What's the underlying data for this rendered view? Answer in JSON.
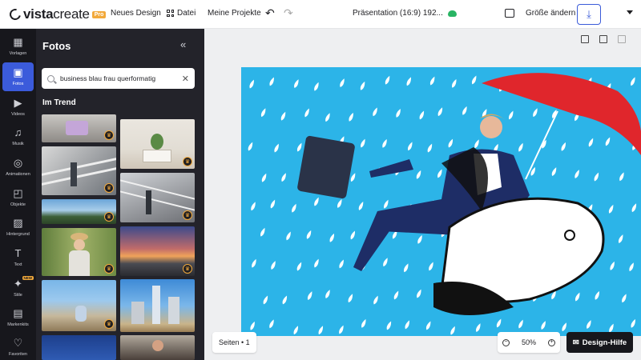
{
  "app": {
    "brand_bold": "vista",
    "brand_light": "create",
    "pro_badge": "Pro"
  },
  "topbar": {
    "new_design": "Neues Design",
    "file": "Datei",
    "my_projects": "Meine Projekte",
    "presentation_title": "Präsentation (16:9) 192...",
    "resize": "Größe ändern"
  },
  "rail": {
    "items": [
      {
        "label": "Vorlagen",
        "icon": "templates-icon"
      },
      {
        "label": "Fotos",
        "icon": "photos-icon"
      },
      {
        "label": "Videos",
        "icon": "videos-icon"
      },
      {
        "label": "Musik",
        "icon": "music-icon"
      },
      {
        "label": "Animationen",
        "icon": "animations-icon"
      },
      {
        "label": "Objekte",
        "icon": "objects-icon"
      },
      {
        "label": "Hintergrund",
        "icon": "background-icon"
      },
      {
        "label": "Text",
        "icon": "text-icon"
      },
      {
        "label": "Stile",
        "icon": "styles-icon",
        "badge": "NEW"
      },
      {
        "label": "Markenkits",
        "icon": "brandkit-icon"
      },
      {
        "label": "Favoriten",
        "icon": "favorites-icon"
      }
    ]
  },
  "panel": {
    "title": "Fotos",
    "search_value": "business blau frau querformatig",
    "section": "Im Trend"
  },
  "workspace": {
    "pages_label": "Seiten • 1",
    "zoom": "50%",
    "help": "Design-Hilfe"
  },
  "colors": {
    "accent": "#3b5bdb",
    "pro": "#f2a93b",
    "canvas_bg": "#2cb4e8",
    "umbrella": "#e0262c"
  }
}
